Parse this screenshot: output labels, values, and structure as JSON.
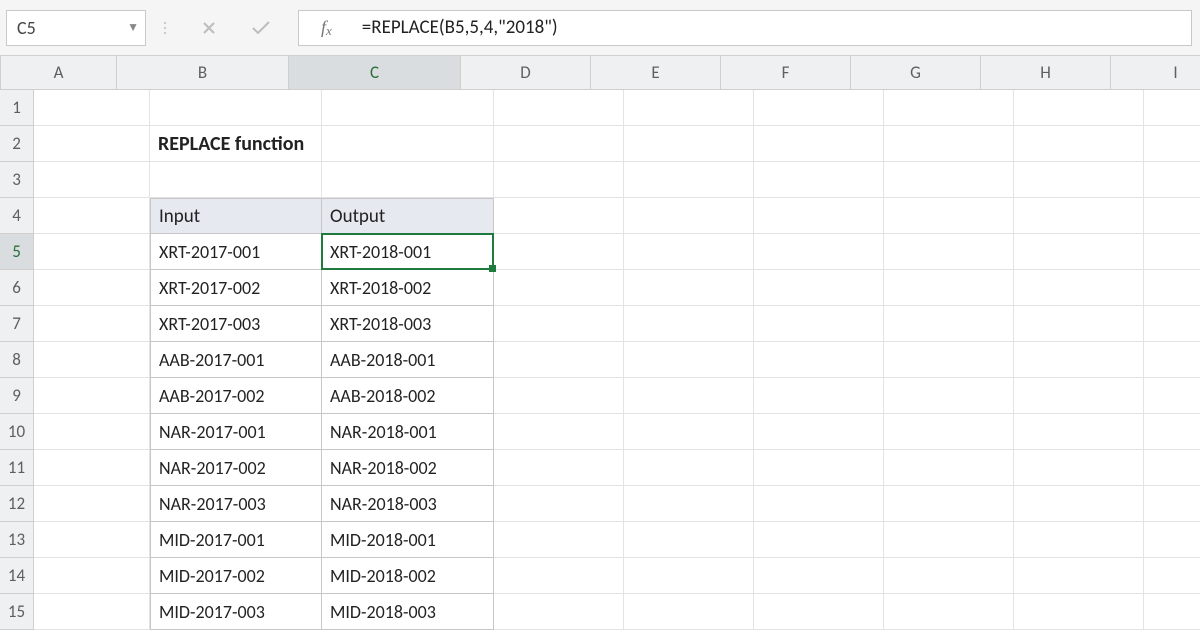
{
  "name_box": "C5",
  "formula": "=REPLACE(B5,5,4,\"2018\")",
  "columns": [
    "A",
    "B",
    "C",
    "D",
    "E",
    "F",
    "G",
    "H",
    "I"
  ],
  "active_column": "C",
  "rows": [
    "1",
    "2",
    "3",
    "4",
    "5",
    "6",
    "7",
    "8",
    "9",
    "10",
    "11",
    "12",
    "13",
    "14",
    "15"
  ],
  "active_row": "5",
  "title": "REPLACE function",
  "table": {
    "headers": {
      "input": "Input",
      "output": "Output"
    },
    "rows": [
      {
        "input": "XRT-2017-001",
        "output": "XRT-2018-001"
      },
      {
        "input": "XRT-2017-002",
        "output": "XRT-2018-002"
      },
      {
        "input": "XRT-2017-003",
        "output": "XRT-2018-003"
      },
      {
        "input": "AAB-2017-001",
        "output": "AAB-2018-001"
      },
      {
        "input": "AAB-2017-002",
        "output": "AAB-2018-002"
      },
      {
        "input": "NAR-2017-001",
        "output": "NAR-2018-001"
      },
      {
        "input": "NAR-2017-002",
        "output": "NAR-2018-002"
      },
      {
        "input": "NAR-2017-003",
        "output": "NAR-2018-003"
      },
      {
        "input": "MID-2017-001",
        "output": "MID-2018-001"
      },
      {
        "input": "MID-2017-002",
        "output": "MID-2018-002"
      },
      {
        "input": "MID-2017-003",
        "output": "MID-2018-003"
      }
    ]
  },
  "active_cell": {
    "col": "C",
    "row": 5
  }
}
